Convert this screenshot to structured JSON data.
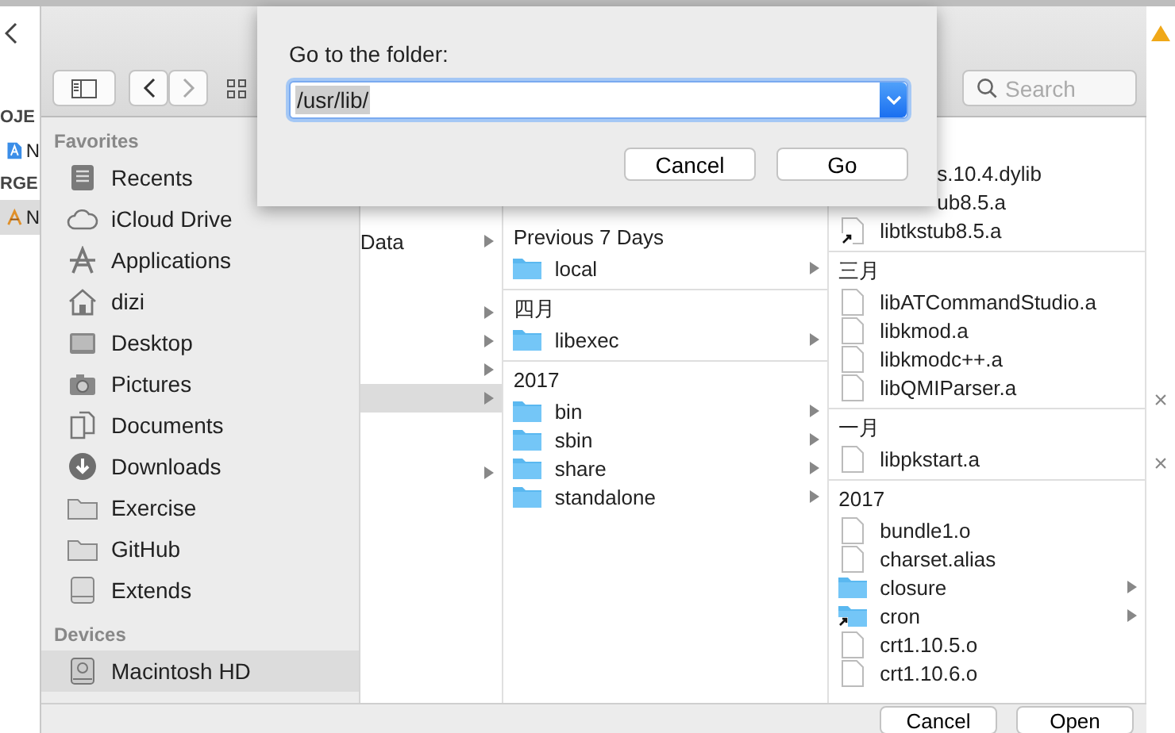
{
  "background_left": {
    "sections": [
      {
        "header": "OJE",
        "item": "N",
        "selected": false
      },
      {
        "header": "RGE",
        "item": "N",
        "selected": true
      }
    ]
  },
  "background_right": {
    "close_marks": [
      "×",
      "×"
    ]
  },
  "finder": {
    "search": {
      "placeholder": "Search"
    },
    "sidebar": [
      {
        "title": "Favorites",
        "items": [
          {
            "label": "Recents",
            "selected": false
          },
          {
            "label": "iCloud Drive",
            "selected": false
          },
          {
            "label": "Applications",
            "selected": false
          },
          {
            "label": "dizi",
            "selected": false
          },
          {
            "label": "Desktop",
            "selected": false
          },
          {
            "label": "Pictures",
            "selected": false
          },
          {
            "label": "Documents",
            "selected": false
          },
          {
            "label": "Downloads",
            "selected": false
          },
          {
            "label": "Exercise",
            "selected": false
          },
          {
            "label": "GitHub",
            "selected": false
          },
          {
            "label": "Extends",
            "selected": false
          }
        ]
      },
      {
        "title": "Devices",
        "items": [
          {
            "label": "Macintosh HD",
            "selected": true
          }
        ]
      }
    ],
    "column_1": [
      {
        "rows": [
          {
            "label": "Data",
            "expandable": true,
            "selected": false
          }
        ]
      },
      {
        "rows": [
          {
            "expandable": true,
            "selected": false
          },
          {
            "expandable": true,
            "selected": false
          },
          {
            "expandable": true,
            "selected": false
          },
          {
            "expandable": true,
            "selected": true
          }
        ]
      },
      {
        "rows": [
          {
            "expandable": true,
            "selected": false
          }
        ]
      }
    ],
    "column_2": [
      {
        "header": "Previous 7 Days",
        "items": [
          {
            "name": "local",
            "kind": "folder",
            "alias": false,
            "expandable": true
          }
        ]
      },
      {
        "header": "四月",
        "items": [
          {
            "name": "libexec",
            "kind": "folder",
            "alias": false,
            "expandable": true
          }
        ]
      },
      {
        "header": "2017",
        "items": [
          {
            "name": "bin",
            "kind": "folder",
            "alias": false,
            "expandable": true
          },
          {
            "name": "sbin",
            "kind": "folder",
            "alias": false,
            "expandable": true
          },
          {
            "name": "share",
            "kind": "folder",
            "alias": false,
            "expandable": true
          },
          {
            "name": "standalone",
            "kind": "folder",
            "alias": false,
            "expandable": true
          }
        ]
      }
    ],
    "column_3": [
      {
        "items": [
          {
            "name": "s.10.4.dylib",
            "kind": "covered"
          },
          {
            "name": "ub8.5.a",
            "kind": "covered"
          },
          {
            "name": "libtkstub8.5.a",
            "kind": "file",
            "alias": true,
            "expandable": false
          }
        ]
      },
      {
        "header": "三月",
        "items": [
          {
            "name": "libATCommandStudio.a",
            "kind": "file",
            "alias": false,
            "expandable": false
          },
          {
            "name": "libkmod.a",
            "kind": "file",
            "alias": false,
            "expandable": false
          },
          {
            "name": "libkmodc++.a",
            "kind": "file",
            "alias": false,
            "expandable": false
          },
          {
            "name": "libQMIParser.a",
            "kind": "file",
            "alias": false,
            "expandable": false
          }
        ]
      },
      {
        "header": "一月",
        "items": [
          {
            "name": "libpkstart.a",
            "kind": "file",
            "alias": false,
            "expandable": false
          }
        ]
      },
      {
        "header": "2017",
        "items": [
          {
            "name": "bundle1.o",
            "kind": "file",
            "alias": false,
            "expandable": false
          },
          {
            "name": "charset.alias",
            "kind": "file",
            "alias": false,
            "expandable": false
          },
          {
            "name": "closure",
            "kind": "folder",
            "alias": false,
            "expandable": true
          },
          {
            "name": "cron",
            "kind": "folder",
            "alias": true,
            "expandable": true
          },
          {
            "name": "crt1.10.5.o",
            "kind": "file",
            "alias": false,
            "expandable": false
          },
          {
            "name": "crt1.10.6.o",
            "kind": "file",
            "alias": false,
            "expandable": false
          }
        ]
      }
    ],
    "buttons": [
      "Cancel",
      "Open"
    ]
  },
  "go_to_folder_sheet": {
    "title": "Go to the folder:",
    "path": "/usr/lib/",
    "path_selected": true,
    "buttons": [
      {
        "label": "Cancel",
        "default": false
      },
      {
        "label": "Go",
        "default": false
      }
    ]
  }
}
